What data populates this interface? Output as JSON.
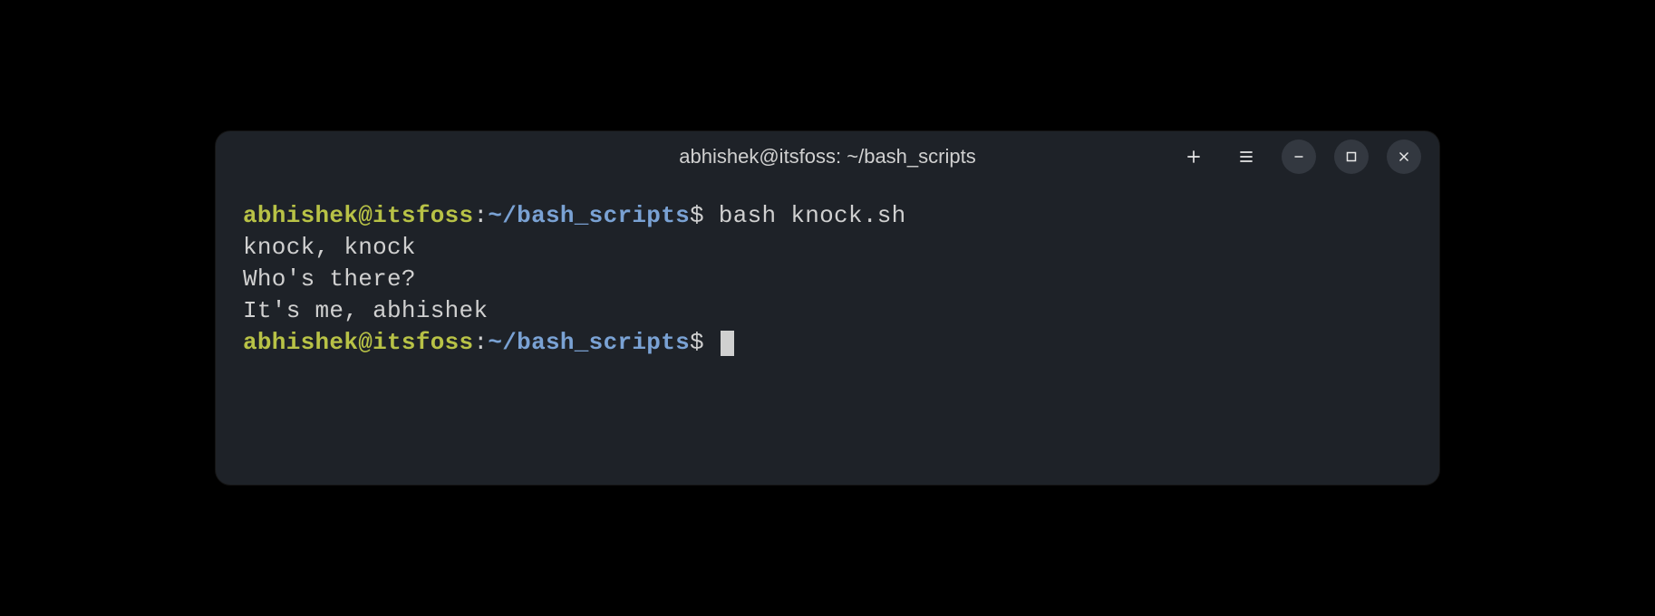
{
  "titlebar": {
    "title": "abhishek@itsfoss: ~/bash_scripts"
  },
  "prompt": {
    "user_host": "abhishek@itsfoss",
    "colon": ":",
    "path": "~/bash_scripts",
    "dollar": "$"
  },
  "session": {
    "command1": " bash knock.sh",
    "output1": "knock, knock",
    "output2": "Who's there?",
    "output3": "It's me, abhishek",
    "command2": " "
  }
}
